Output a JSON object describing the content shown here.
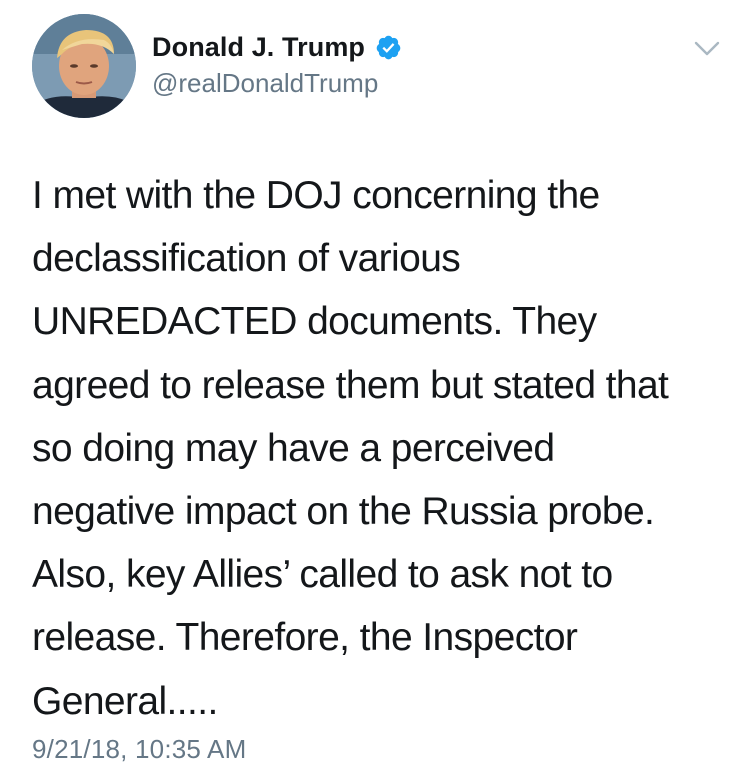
{
  "tweet": {
    "author": {
      "display_name": "Donald J. Trump",
      "handle": "@realDonaldTrump",
      "verified": true,
      "avatar_icon": "profile-photo"
    },
    "menu_icon": "chevron-down-icon",
    "text_lines": [
      "I met with the DOJ concerning the",
      "declassification of various",
      "UNREDACTED documents. They",
      "agreed to release them but stated that",
      "so doing may have a perceived",
      "negative impact on the Russia probe.",
      "Also, key Allies’ called to ask not to",
      "release. Therefore, the Inspector",
      "General....."
    ],
    "timestamp": "9/21/18, 10:35 AM"
  },
  "colors": {
    "primary_text": "#14171a",
    "secondary_text": "#657786",
    "verified_badge": "#1da1f2",
    "caret": "#aab8c2",
    "background": "#ffffff"
  }
}
